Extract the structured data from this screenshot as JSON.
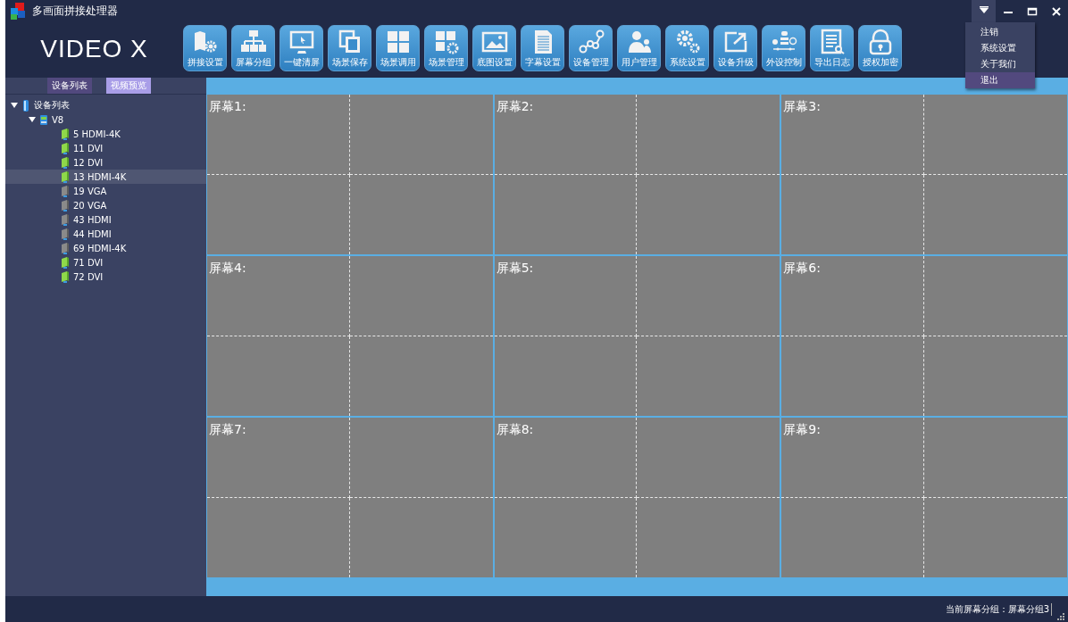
{
  "window": {
    "title": "多画面拼接处理器"
  },
  "logo": "VIDEO X",
  "toolbar": [
    {
      "label": "拼接设置"
    },
    {
      "label": "屏幕分组"
    },
    {
      "label": "一键清屏"
    },
    {
      "label": "场景保存"
    },
    {
      "label": "场景调用"
    },
    {
      "label": "场景管理"
    },
    {
      "label": "底图设置"
    },
    {
      "label": "字幕设置"
    },
    {
      "label": "设备管理"
    },
    {
      "label": "用户管理"
    },
    {
      "label": "系统设置"
    },
    {
      "label": "设备升级"
    },
    {
      "label": "外设控制"
    },
    {
      "label": "导出日志"
    },
    {
      "label": "授权加密"
    }
  ],
  "menu": [
    {
      "label": "注销",
      "selected": false
    },
    {
      "label": "系统设置",
      "selected": false
    },
    {
      "label": "关于我们",
      "selected": false
    },
    {
      "label": "退出",
      "selected": true
    }
  ],
  "tabs": [
    {
      "label": "设备列表",
      "selected": false
    },
    {
      "label": "视频预览",
      "selected": true
    }
  ],
  "tree": {
    "label": "设备列表",
    "expanded": true,
    "children": [
      {
        "label": "V8",
        "expanded": true,
        "children": [
          {
            "label": "5 HDMI-4K",
            "online": true,
            "selected": false
          },
          {
            "label": "11 DVI",
            "online": true,
            "selected": false
          },
          {
            "label": "12 DVI",
            "online": true,
            "selected": false
          },
          {
            "label": "13 HDMI-4K",
            "online": true,
            "selected": true
          },
          {
            "label": "19 VGA",
            "online": false,
            "selected": false
          },
          {
            "label": "20 VGA",
            "online": false,
            "selected": false
          },
          {
            "label": "43 HDMI",
            "online": false,
            "selected": false
          },
          {
            "label": "44 HDMI",
            "online": false,
            "selected": false
          },
          {
            "label": "69 HDMI-4K",
            "online": false,
            "selected": false
          },
          {
            "label": "71 DVI",
            "online": true,
            "selected": false
          },
          {
            "label": "72 DVI",
            "online": true,
            "selected": false
          }
        ]
      }
    ]
  },
  "screens": [
    {
      "label": "屏幕1:"
    },
    {
      "label": "屏幕2:"
    },
    {
      "label": "屏幕3:"
    },
    {
      "label": "屏幕4:"
    },
    {
      "label": "屏幕5:"
    },
    {
      "label": "屏幕6:"
    },
    {
      "label": "屏幕7:"
    },
    {
      "label": "屏幕8:"
    },
    {
      "label": "屏幕9:"
    }
  ],
  "status_bar": {
    "text": "当前屏幕分组：屏幕分组3"
  }
}
